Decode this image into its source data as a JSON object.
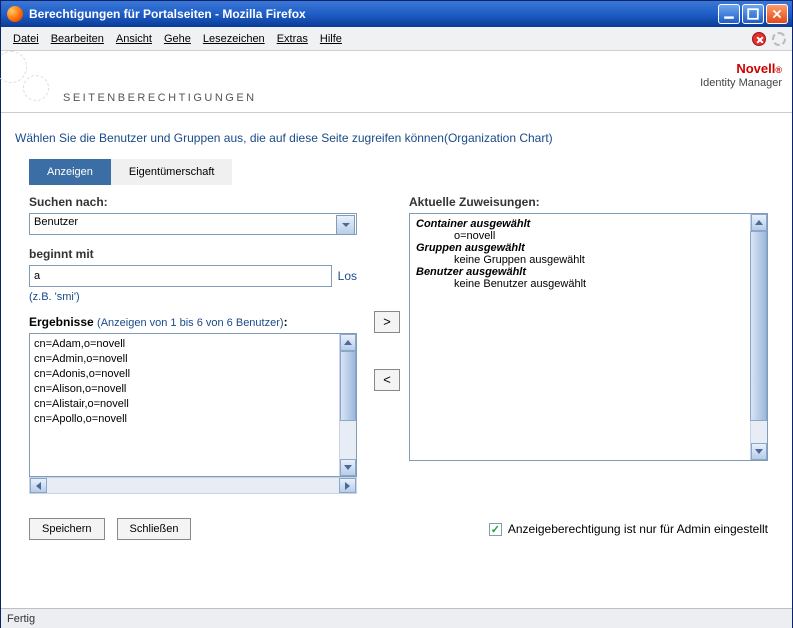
{
  "window": {
    "title": "Berechtigungen für Portalseiten - Mozilla Firefox"
  },
  "menu": {
    "file": "Datei",
    "edit": "Bearbeiten",
    "view": "Ansicht",
    "go": "Gehe",
    "bookmarks": "Lesezeichen",
    "extras": "Extras",
    "help": "Hilfe"
  },
  "brand": {
    "name": "Novell",
    "reg": "®",
    "sub": "Identity Manager"
  },
  "page": {
    "title": "SEITENBERECHTIGUNGEN",
    "instruction": "Wählen Sie die Benutzer und Gruppen aus, die auf diese Seite zugreifen können(Organization Chart)"
  },
  "tabs": {
    "view": "Anzeigen",
    "ownership": "Eigentümerschaft"
  },
  "search": {
    "label": "Suchen nach:",
    "type_value": "Benutzer",
    "begins_label": "beginnt mit",
    "begins_value": "a",
    "go": "Los",
    "hint": "(z.B. 'smi')"
  },
  "results": {
    "label": "Ergebnisse",
    "sub": "(Anzeigen von 1 bis 6 von 6 Benutzer)",
    "items": [
      "cn=Adam,o=novell",
      "cn=Admin,o=novell",
      "cn=Adonis,o=novell",
      "cn=Alison,o=novell",
      "cn=Alistair,o=novell",
      "cn=Apollo,o=novell"
    ]
  },
  "move": {
    "add": ">",
    "remove": "<"
  },
  "assignments": {
    "label": "Aktuelle Zuweisungen:",
    "container_heading": "Container ausgewählt",
    "container_value": "o=novell",
    "groups_heading": "Gruppen ausgewählt",
    "groups_value": "keine Gruppen ausgewählt",
    "users_heading": "Benutzer ausgewählt",
    "users_value": "keine Benutzer ausgewählt"
  },
  "footer": {
    "save": "Speichern",
    "close": "Schließen",
    "checkbox_label": "Anzeigeberechtigung ist nur für Admin eingestellt",
    "checkbox_checked": true
  },
  "status": {
    "text": "Fertig"
  }
}
